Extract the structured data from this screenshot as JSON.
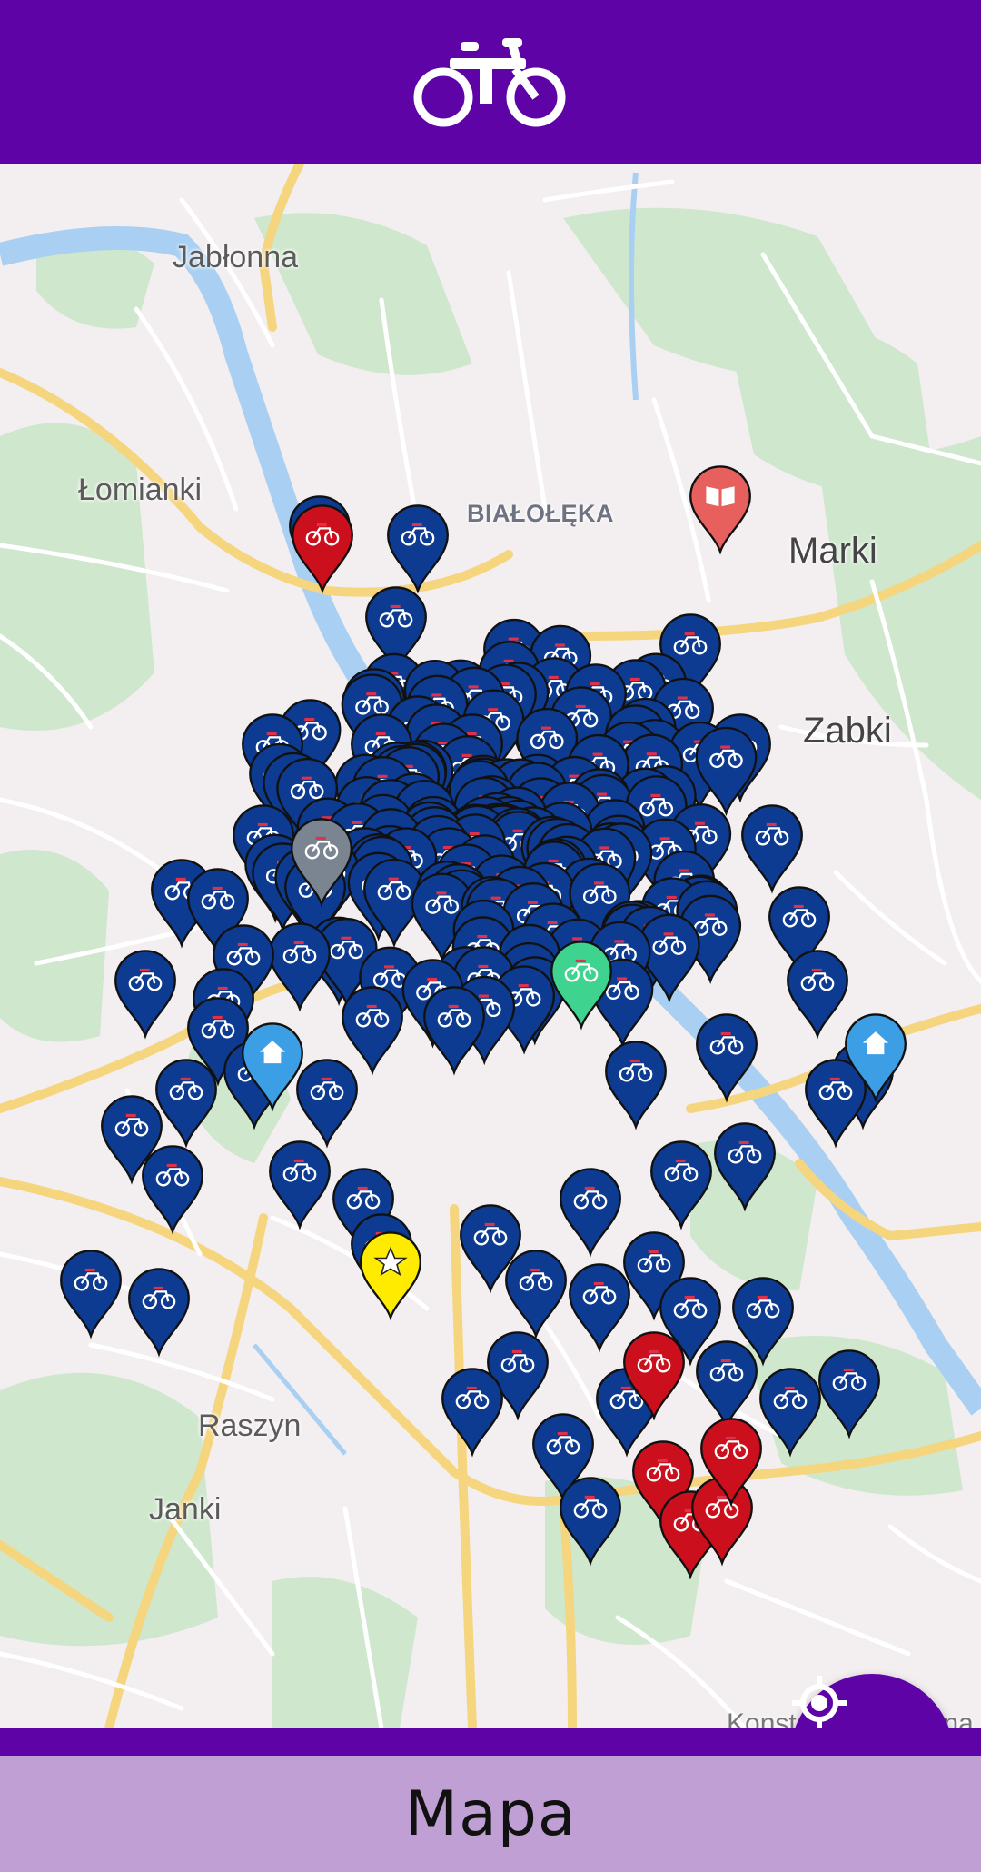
{
  "app": {
    "header_icon": "bike-icon",
    "accent_color": "#5e03a6",
    "bottom_bar_color": "#bf9fd4"
  },
  "map": {
    "places": {
      "jablonna": "Jabłonna",
      "lomianki": "Łomianki",
      "bialoleka": "BIAŁOŁĘKA",
      "marki": "Marki",
      "zabki": "Zabki",
      "raszyn": "Raszyn",
      "janki": "Janki",
      "konstancin": "Konstancin-Jeziorna"
    },
    "marker_colors": {
      "station": "#0d3b91",
      "station_unavailable": "#cb0f1c",
      "station_inactive": "#7a8591",
      "favorite": "#ffeb00",
      "info": "#e8605e",
      "service": "#3c9fe6",
      "selected": "#3fd390"
    },
    "marker_icons": {
      "station": "bike-icon",
      "favorite": "star-icon",
      "info": "book-icon",
      "service": "house-icon"
    }
  },
  "fab": {
    "icon": "my-location-icon"
  },
  "bottom_bar": {
    "title": "Mapa"
  }
}
